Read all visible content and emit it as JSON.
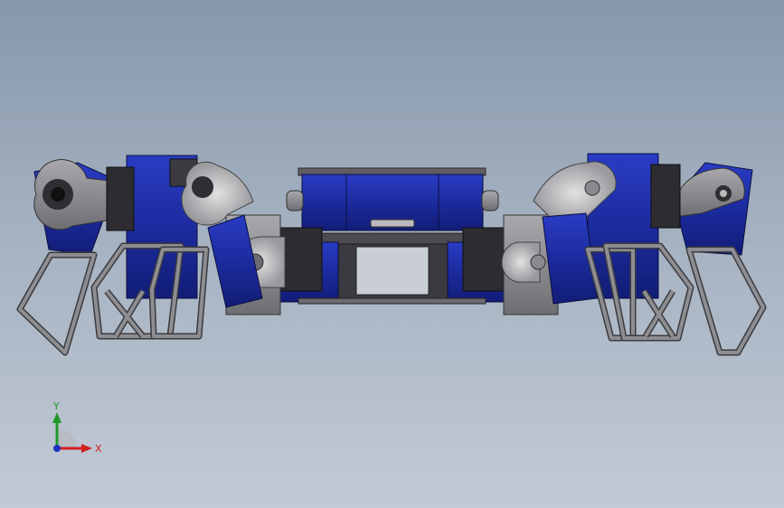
{
  "viewport": {
    "colors": {
      "background_top": "#8797ab",
      "background_bottom": "#c2cad5",
      "part_blue": "#1c2b9e",
      "part_blue_dark": "#0f1a6e",
      "part_grey": "#8a8a8e",
      "part_light": "#c7c7ca",
      "part_black": "#2a2a2e"
    }
  },
  "triad": {
    "x_label": "X",
    "y_label": "Y",
    "x_color": "#d12020",
    "y_color": "#1f9a2a",
    "z_color": "#2030c0"
  }
}
